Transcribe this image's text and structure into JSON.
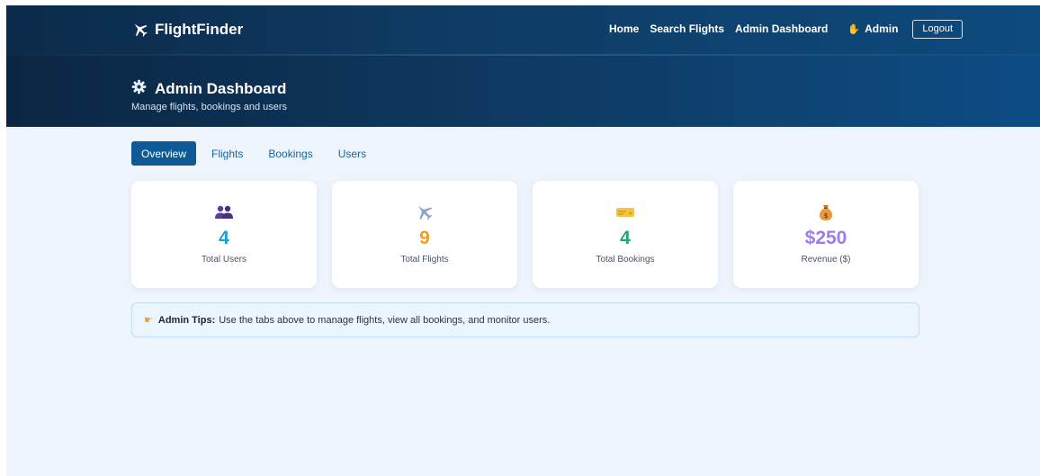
{
  "brand": {
    "name": "FlightFinder",
    "icon": "airplane-icon"
  },
  "nav": {
    "links": [
      "Home",
      "Search Flights",
      "Admin Dashboard"
    ],
    "user_label": "Admin",
    "user_icon": "waving-hand-icon",
    "logout_label": "Logout"
  },
  "hero": {
    "title": "Admin Dashboard",
    "title_icon": "gear-icon",
    "subtitle": "Manage flights, bookings and users"
  },
  "tabs": [
    {
      "label": "Overview",
      "active": true
    },
    {
      "label": "Flights",
      "active": false
    },
    {
      "label": "Bookings",
      "active": false
    },
    {
      "label": "Users",
      "active": false
    }
  ],
  "stats": [
    {
      "icon": "users-icon",
      "value": "4",
      "label": "Total Users",
      "color": "#1a9fd8"
    },
    {
      "icon": "airplane-icon",
      "value": "9",
      "label": "Total Flights",
      "color": "#f0a020"
    },
    {
      "icon": "ticket-icon",
      "value": "4",
      "label": "Total Bookings",
      "color": "#1faa6a"
    },
    {
      "icon": "money-bag-icon",
      "value": "$250",
      "label": "Revenue ($)",
      "color": "#a07bea"
    }
  ],
  "tips": {
    "icon": "pointing-hand-icon",
    "title": "Admin Tips:",
    "text": "Use the tabs above to manage flights, view all bookings, and monitor users."
  },
  "colors": {
    "header_dark": "#0c2a4a",
    "header_light": "#0d4a7e",
    "page_bg": "#eef4fc",
    "tab_active": "#0d5a96",
    "link": "#1565a6"
  }
}
